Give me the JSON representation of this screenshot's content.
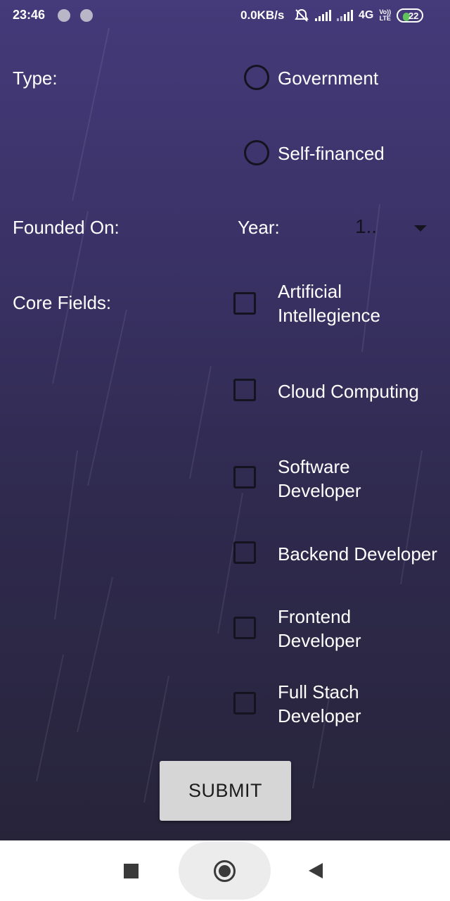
{
  "status_bar": {
    "time": "23:46",
    "network_speed": "0.0KB/s",
    "network_type": "4G",
    "volte_label_top": "Vo))",
    "volte_label_bottom": "LTE",
    "battery_level": "22",
    "battery_color": "#5fc35a"
  },
  "form": {
    "type": {
      "label": "Type:",
      "options": [
        "Government",
        "Self-financed"
      ]
    },
    "founded": {
      "label": "Founded On:",
      "year_label": "Year:",
      "year_value": "1.."
    },
    "core_fields": {
      "label": "Core Fields:",
      "options": [
        {
          "line1": "Artificial",
          "line2": "Intellegience"
        },
        {
          "line1": "Cloud Computing",
          "line2": ""
        },
        {
          "line1": "Software",
          "line2": "Developer"
        },
        {
          "line1": "Backend Developer",
          "line2": ""
        },
        {
          "line1": "Frontend",
          "line2": "Developer"
        },
        {
          "line1": "Full Stach",
          "line2": "Developer"
        }
      ]
    },
    "submit_label": "SUBMIT"
  },
  "nav_bar": {
    "icons": [
      "recents-icon",
      "home-icon",
      "back-icon"
    ]
  }
}
